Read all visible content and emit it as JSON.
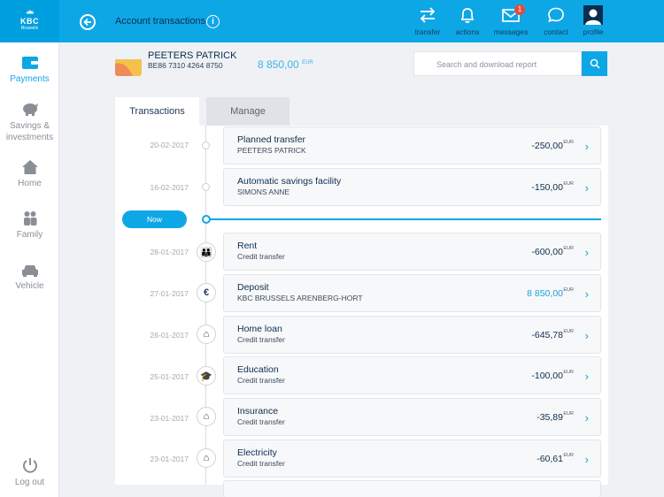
{
  "brand": {
    "logo_main": "KBC",
    "logo_sub": "Brussels"
  },
  "header": {
    "title": "Account transactions",
    "info_glyph": "i",
    "actions": [
      {
        "icon": "transfer-icon",
        "label": "transfer"
      },
      {
        "icon": "bell-icon",
        "label": "actions"
      },
      {
        "icon": "envelope-icon",
        "label": "messages",
        "badge": "1"
      },
      {
        "icon": "chat-icon",
        "label": "contact"
      },
      {
        "icon": "profile-icon",
        "label": "profile"
      }
    ]
  },
  "sidebar": {
    "items": [
      {
        "icon": "wallet-icon",
        "label": "Payments",
        "active": true
      },
      {
        "icon": "piggy-bank-icon",
        "label": "Savings & investments",
        "active": false
      },
      {
        "icon": "home-icon",
        "label": "Home",
        "active": false
      },
      {
        "icon": "family-icon",
        "label": "Family",
        "active": false
      },
      {
        "icon": "car-icon",
        "label": "Vehicle",
        "active": false
      }
    ],
    "logout": "Log out"
  },
  "account": {
    "holder": "PEETERS PATRICK",
    "iban": "BE86 7310 4264 8750",
    "balance": "8 850,00",
    "currency": "EUR"
  },
  "search": {
    "placeholder": "Search and download report"
  },
  "tabs": {
    "active": "Transactions",
    "inactive": "Manage"
  },
  "now_label": "Now",
  "planned": [
    {
      "date": "20-02-2017",
      "title": "Planned transfer",
      "subtitle": "PEETERS PATRICK",
      "amount": "-250,00",
      "currency": "EUR"
    },
    {
      "date": "16-02-2017",
      "title": "Automatic savings facility",
      "subtitle": "SIMONS ANNE",
      "amount": "-150,00",
      "currency": "EUR"
    }
  ],
  "transactions": [
    {
      "date": "28-01-2017",
      "icon": "family-icon",
      "glyph": "👪",
      "title": "Rent",
      "subtitle": "Credit transfer",
      "amount": "-600,00",
      "currency": "EUR",
      "positive": false
    },
    {
      "date": "27-01-2017",
      "icon": "euro-icon",
      "glyph": "€",
      "title": "Deposit",
      "subtitle": "KBC BRUSSELS ARENBERG-HORT",
      "amount": "8 850,00",
      "currency": "EUR",
      "positive": true
    },
    {
      "date": "26-01-2017",
      "icon": "home-icon",
      "glyph": "⌂",
      "title": "Home loan",
      "subtitle": "Credit transfer",
      "amount": "-645,78",
      "currency": "EUR",
      "positive": false
    },
    {
      "date": "25-01-2017",
      "icon": "graduation-cap-icon",
      "glyph": "🎓",
      "title": "Education",
      "subtitle": "Credit transfer",
      "amount": "-100,00",
      "currency": "EUR",
      "positive": false
    },
    {
      "date": "23-01-2017",
      "icon": "home-icon",
      "glyph": "⌂",
      "title": "Insurance",
      "subtitle": "Credit transfer",
      "amount": "-35,89",
      "currency": "EUR",
      "positive": false
    },
    {
      "date": "23-01-2017",
      "icon": "home-icon",
      "glyph": "⌂",
      "title": "Electricity",
      "subtitle": "Credit transfer",
      "amount": "-60,61",
      "currency": "EUR",
      "positive": false
    }
  ]
}
